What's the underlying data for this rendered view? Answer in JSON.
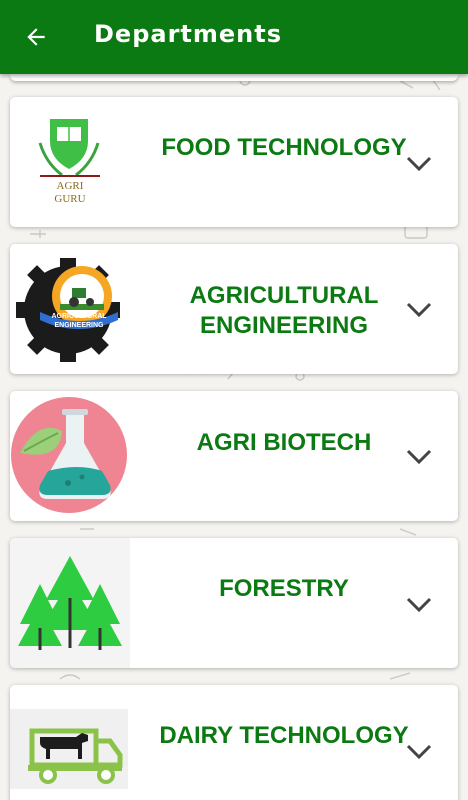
{
  "appbar": {
    "title": "Departments",
    "back_icon": "arrow-left-icon",
    "color": "#0c7a12"
  },
  "accent_text_color": "#0c7a12",
  "departments": [
    {
      "title": "FOOD TECHNOLOGY",
      "logo_text": [
        "AGRI",
        "GURU"
      ],
      "logo_icon": "agri-guru-shield-book-icon",
      "expand_icon": "chevron-down-icon"
    },
    {
      "title": "AGRICULTURAL ENGINEERING",
      "logo_text": [
        "AGRICULTURAL",
        "ENGINEERING"
      ],
      "logo_icon": "gear-tractor-sun-icon",
      "expand_icon": "chevron-down-icon"
    },
    {
      "title": "AGRI BIOTECH",
      "logo_icon": "flask-leaf-icon",
      "expand_icon": "chevron-down-icon"
    },
    {
      "title": "FORESTRY",
      "logo_icon": "pine-trees-icon",
      "expand_icon": "chevron-down-icon"
    },
    {
      "title": "DAIRY TECHNOLOGY",
      "logo_icon": "cow-truck-icon",
      "expand_icon": "chevron-down-icon"
    }
  ]
}
